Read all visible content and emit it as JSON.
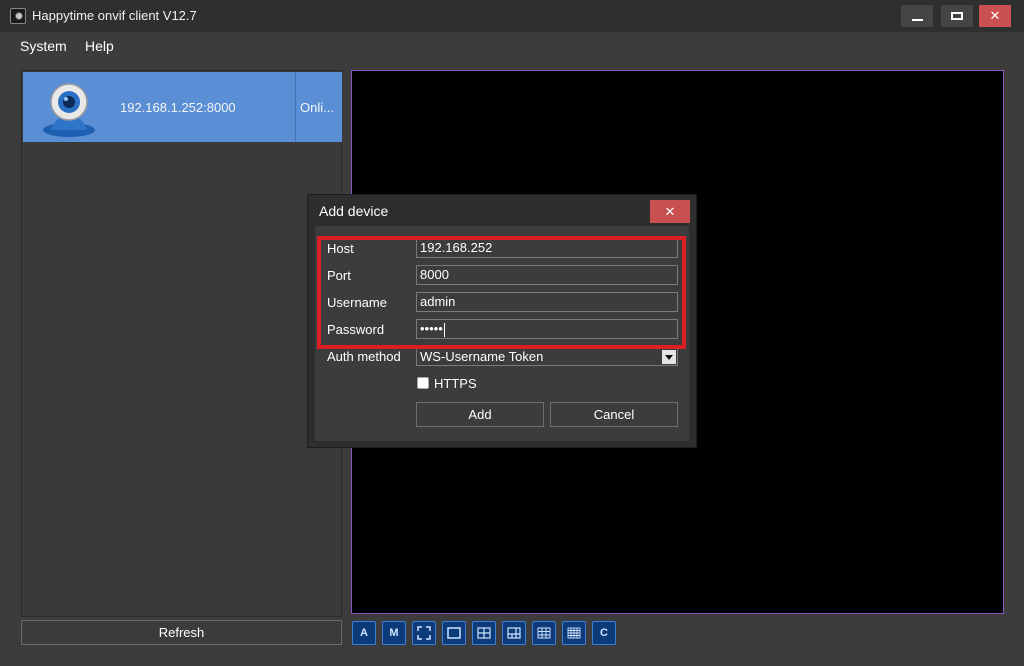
{
  "window": {
    "title": "Happytime onvif client V12.7",
    "minimize_icon": "minimize-icon",
    "maximize_icon": "maximize-icon",
    "close_glyph": "✕"
  },
  "menu": {
    "system": "System",
    "help": "Help"
  },
  "device_list": {
    "items": [
      {
        "address": "192.168.1.252:8000",
        "status": "Onli...",
        "icon": "webcam-icon"
      }
    ],
    "refresh_label": "Refresh"
  },
  "layout_buttons": [
    {
      "name": "layout-a",
      "glyph": "A"
    },
    {
      "name": "layout-m",
      "glyph": "M"
    },
    {
      "name": "fullscreen",
      "glyph": ""
    },
    {
      "name": "layout-1x1",
      "glyph": ""
    },
    {
      "name": "layout-2x2",
      "glyph": ""
    },
    {
      "name": "layout-1plus5",
      "glyph": ""
    },
    {
      "name": "layout-3x3",
      "glyph": ""
    },
    {
      "name": "layout-4x4",
      "glyph": ""
    },
    {
      "name": "layout-custom",
      "glyph": "C"
    }
  ],
  "dialog": {
    "title": "Add device",
    "close_glyph": "✕",
    "host_label": "Host",
    "host_value": "192.168.252",
    "port_label": "Port",
    "port_value": "8000",
    "username_label": "Username",
    "username_value": "admin",
    "password_label": "Password",
    "password_value": "•••••",
    "auth_label": "Auth method",
    "auth_value": "WS-Username Token",
    "https_label": "HTTPS",
    "https_checked": false,
    "add_label": "Add",
    "cancel_label": "Cancel"
  },
  "colors": {
    "selected_row": "#5a8fd6",
    "close_red": "#c9504e",
    "highlight_red": "#dc1f24",
    "video_border": "#8a56c4"
  }
}
